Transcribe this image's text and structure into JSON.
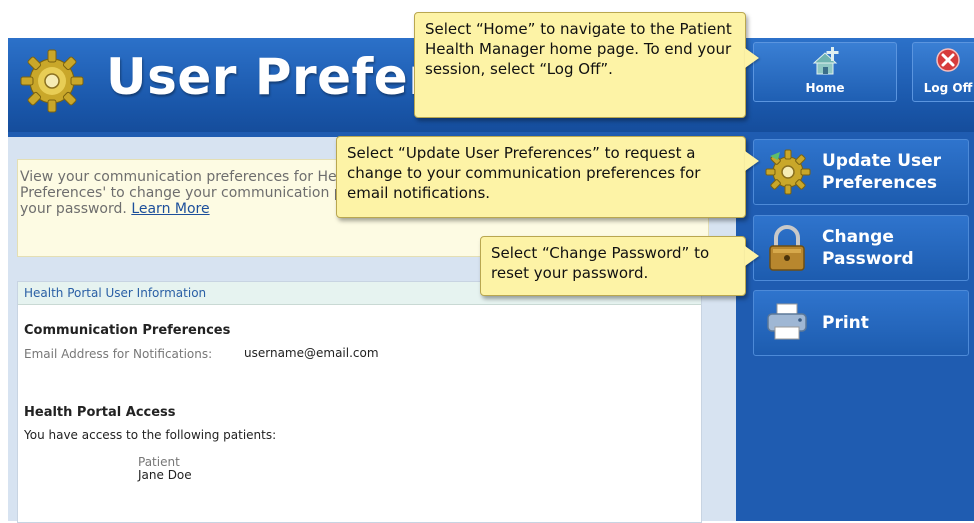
{
  "header": {
    "title": "User Preferences",
    "home_label": "Home",
    "logoff_label": "Log Off"
  },
  "info": {
    "text": "View your communication preferences for Health Portal for this patient. Select 'Update User Preferences' to change your communication preferences. Select 'Change Password' to reset your password.",
    "learn_more": "Learn More"
  },
  "panel": {
    "header": "Health Portal User Information",
    "comm_heading": "Communication Preferences",
    "email_label": "Email Address for Notifications:",
    "email_value": "username@email.com",
    "access_heading": "Health Portal Access",
    "access_text": "You have access to the following patients:",
    "patient_col": "Patient",
    "patient_name": "Jane Doe"
  },
  "sidebar": {
    "update_line1": "Update User",
    "update_line2": "Preferences",
    "change_line1": "Change",
    "change_line2": "Password",
    "print_label": "Print"
  },
  "callouts": {
    "home": "Select “Home” to navigate to the Patient Health Manager home page. To end your session, select “Log Off”.",
    "update": "Select “Update User Preferences” to request a change to your communication preferences for email notifications.",
    "password": "Select “Change Password” to reset your password."
  },
  "icons": {
    "logo": "gear-icon",
    "home": "home-icon",
    "logoff": "close-icon",
    "update": "gear-icon",
    "password": "lock-icon",
    "print": "printer-icon"
  },
  "colors": {
    "brand_blue": "#1f5cb1",
    "callout_yellow": "#fdf3a6",
    "note_yellow": "#fdfbe3"
  }
}
